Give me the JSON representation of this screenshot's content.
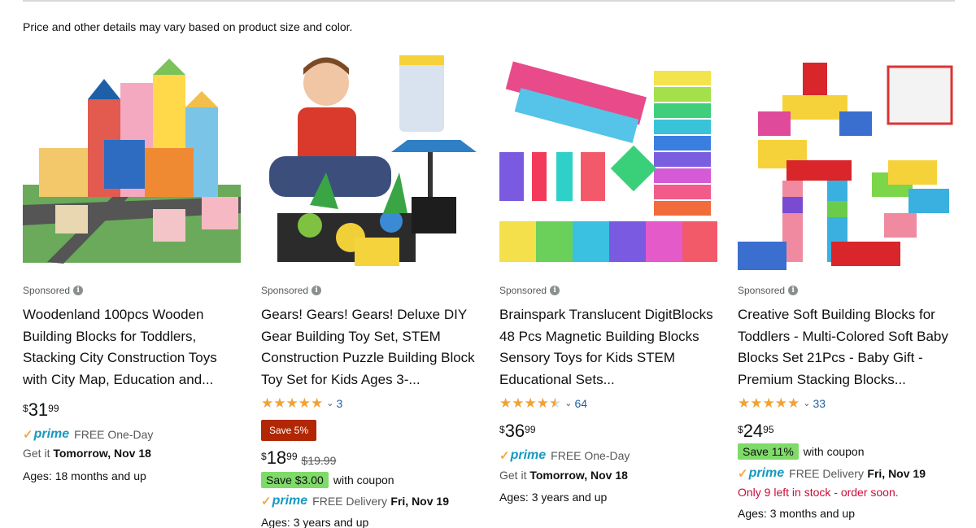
{
  "disclaimer": "Price and other details may vary based on product size and color.",
  "products": [
    {
      "sponsored": "Sponsored",
      "title": "Woodenland 100pcs Wooden Building Blocks for Toddlers, Stacking City Construction Toys with City Map, Education and...",
      "price": {
        "symbol": "$",
        "whole": "31",
        "fraction": "99"
      },
      "prime": "prime",
      "shipping": "FREE One-Day",
      "delivery_prefix": "Get it",
      "delivery_date": "Tomorrow, Nov 18",
      "ages": "Ages: 18 months and up"
    },
    {
      "sponsored": "Sponsored",
      "title": "Gears! Gears! Gears! Deluxe DIY Gear Building Toy Set, STEM Construction Puzzle Building Block Toy Set for Kids Ages 3-...",
      "rating": 5.0,
      "review_count": "3",
      "save_badge": "Save 5%",
      "price": {
        "symbol": "$",
        "whole": "18",
        "fraction": "99"
      },
      "list_price": "$19.99",
      "coupon": "Save $3.00",
      "coupon_suffix": "with coupon",
      "prime": "prime",
      "shipping": "FREE Delivery",
      "delivery_date": "Fri, Nov 19",
      "ages": "Ages: 3 years and up"
    },
    {
      "sponsored": "Sponsored",
      "title": "Brainspark Translucent DigitBlocks 48 Pcs Magnetic Building Blocks Sensory Toys for Kids STEM Educational Sets...",
      "rating": 4.5,
      "review_count": "64",
      "price": {
        "symbol": "$",
        "whole": "36",
        "fraction": "99"
      },
      "prime": "prime",
      "shipping": "FREE One-Day",
      "delivery_prefix": "Get it",
      "delivery_date": "Tomorrow, Nov 18",
      "ages": "Ages: 3 years and up"
    },
    {
      "sponsored": "Sponsored",
      "title": "Creative Soft Building Blocks for Toddlers - Multi-Colored Soft Baby Blocks Set 21Pcs - Baby Gift - Premium Stacking Blocks...",
      "rating": 5.0,
      "review_count": "33",
      "price": {
        "symbol": "$",
        "whole": "24",
        "fraction": "95"
      },
      "coupon": "Save 11%",
      "coupon_suffix": "with coupon",
      "prime": "prime",
      "shipping": "FREE Delivery",
      "delivery_date": "Fri, Nov 19",
      "stock_warning": "Only 9 left in stock - order soon.",
      "ages": "Ages: 3 months and up"
    }
  ],
  "colors": {
    "star": "#f0a235",
    "prime_blue": "#1799c1",
    "link_blue": "#2162a1",
    "save_red": "#b12704",
    "coupon_green": "#7fda69",
    "stock_red": "#cc0c39"
  }
}
